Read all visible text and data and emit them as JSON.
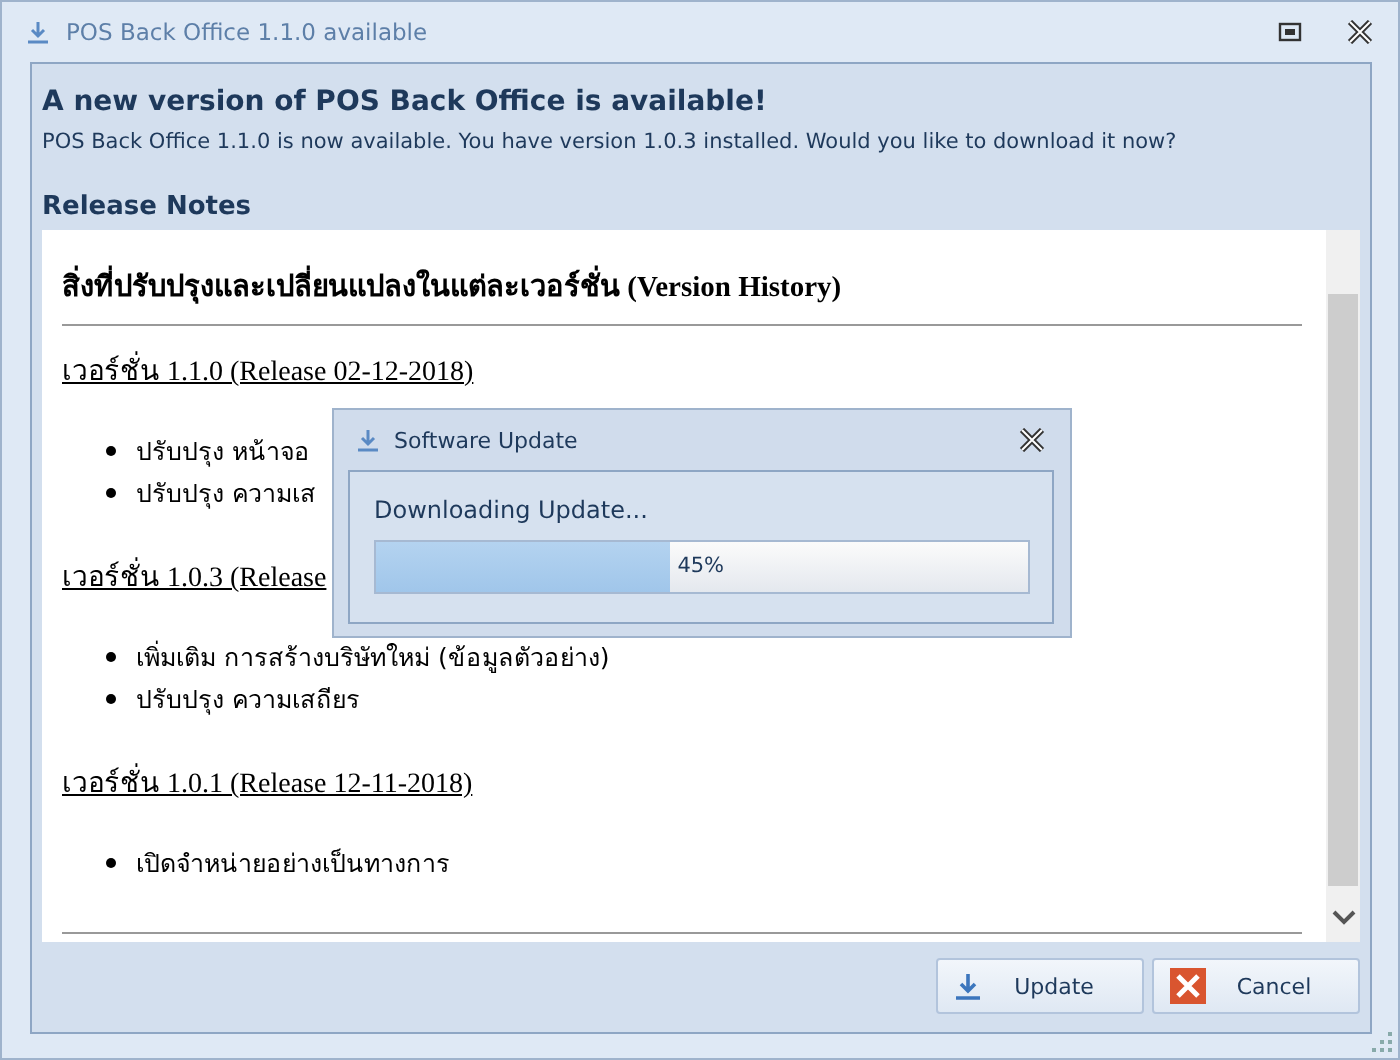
{
  "window": {
    "title": "POS Back Office 1.1.0 available"
  },
  "headline": "A new version of POS Back Office is available!",
  "message": "POS Back Office 1.1.0 is now available. You have version 1.0.3 installed. Would you like to download it now?",
  "release_notes": {
    "label": "Release Notes",
    "heading": "สิ่งที่ปรับปรุงและเปลี่ยนแปลงในแต่ละเวอร์ชั่น (Version History)",
    "versions": [
      {
        "title": "เวอร์ชั่น 1.1.0 (Release 02-12-2018)",
        "items": [
          "ปรับปรุง หน้าจอ",
          "ปรับปรุง ความเส"
        ]
      },
      {
        "title": "เวอร์ชั่น 1.0.3 (Release",
        "items": [
          "เพิ่มเติม การสร้างบริษัทใหม่ (ข้อมูลตัวอย่าง)",
          "ปรับปรุง ความเสถียร"
        ]
      },
      {
        "title": "เวอร์ชั่น 1.0.1 (Release 12-11-2018)",
        "items": [
          "เปิดจำหน่ายอย่างเป็นทางการ"
        ]
      }
    ]
  },
  "buttons": [
    {
      "label": "Update",
      "kind": "download"
    },
    {
      "label": "Cancel",
      "kind": "cancel"
    }
  ],
  "dialog": {
    "title": "Software Update",
    "message": "Downloading Update...",
    "progress": {
      "level": 0.45,
      "reading": "45%"
    }
  }
}
